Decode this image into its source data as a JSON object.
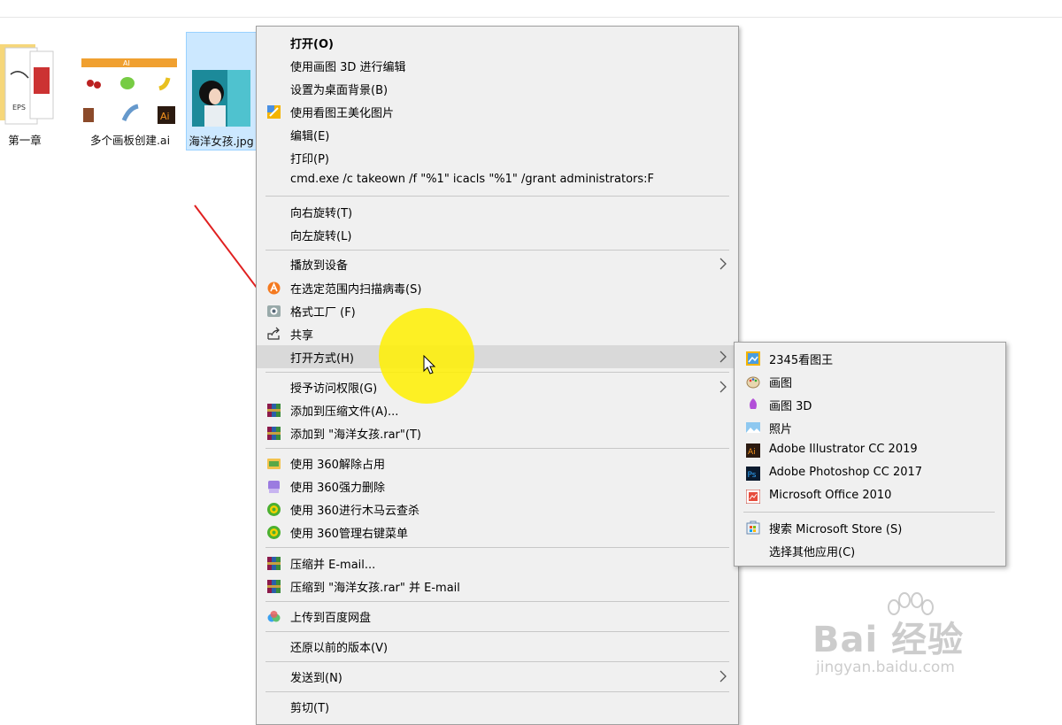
{
  "desktop": {
    "files": [
      {
        "name": "第一章"
      },
      {
        "name": "多个画板创建.ai"
      },
      {
        "name": "海洋女孩.jpg"
      }
    ]
  },
  "context_menu": {
    "items": [
      {
        "label": "打开(O)"
      },
      {
        "label": "使用画图 3D 进行编辑"
      },
      {
        "label": "设置为桌面背景(B)"
      },
      {
        "label": "使用看图王美化图片"
      },
      {
        "label": "编辑(E)"
      },
      {
        "label": "打印(P)"
      },
      {
        "label": "cmd.exe /c takeown /f \"%1\"  icacls \"%1\" /grant administrators:F"
      },
      {
        "label": "向右旋转(T)"
      },
      {
        "label": "向左旋转(L)"
      },
      {
        "label": "播放到设备"
      },
      {
        "label": "在选定范围内扫描病毒(S)"
      },
      {
        "label": "格式工厂 (F)"
      },
      {
        "label": "共享"
      },
      {
        "label": "打开方式(H)"
      },
      {
        "label": "授予访问权限(G)"
      },
      {
        "label": "添加到压缩文件(A)..."
      },
      {
        "label": "添加到 \"海洋女孩.rar\"(T)"
      },
      {
        "label": "使用 360解除占用"
      },
      {
        "label": "使用 360强力删除"
      },
      {
        "label": "使用 360进行木马云查杀"
      },
      {
        "label": "使用 360管理右键菜单"
      },
      {
        "label": "压缩并 E-mail..."
      },
      {
        "label": "压缩到 \"海洋女孩.rar\" 并 E-mail"
      },
      {
        "label": "上传到百度网盘"
      },
      {
        "label": "还原以前的版本(V)"
      },
      {
        "label": "发送到(N)"
      },
      {
        "label": "剪切(T)"
      }
    ]
  },
  "open_with_submenu": {
    "items": [
      {
        "label": "2345看图王"
      },
      {
        "label": "画图"
      },
      {
        "label": "画图 3D"
      },
      {
        "label": "照片"
      },
      {
        "label": "Adobe Illustrator CC 2019"
      },
      {
        "label": "Adobe Photoshop CC 2017"
      },
      {
        "label": "Microsoft Office 2010"
      },
      {
        "label": "搜索 Microsoft Store (S)"
      },
      {
        "label": "选择其他应用(C)"
      }
    ]
  },
  "thumb_labels": {
    "ai_banner": "AI",
    "ai_badge": "Ai",
    "eps": "EPS"
  },
  "watermark": {
    "line1": "Bai 经验",
    "line2": "jingyan.baidu.com"
  },
  "colors": {
    "highlight": "#d9d9d9",
    "selection": "#cce8ff",
    "arrow": "#e02020",
    "cursor_spot": "#fff000"
  }
}
